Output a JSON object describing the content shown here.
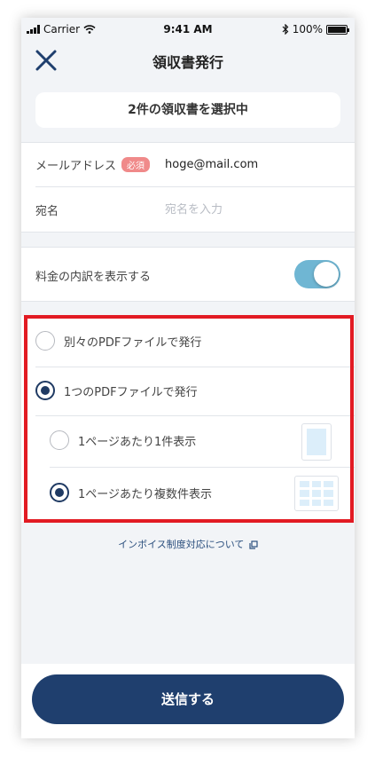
{
  "status_bar": {
    "carrier": "Carrier",
    "time": "9:41 AM",
    "battery": "100%"
  },
  "nav": {
    "title": "領収書発行"
  },
  "selection": {
    "summary": "2件の領収書を選択中"
  },
  "form": {
    "email_label": "メールアドレス",
    "required_badge": "必須",
    "email_value": "hoge@mail.com",
    "address_label": "宛名",
    "address_placeholder": "宛名を入力"
  },
  "breakdown": {
    "label": "料金の内訳を表示する",
    "enabled": true
  },
  "options": {
    "separate_pdf": "別々のPDFファイルで発行",
    "single_pdf": "1つのPDFファイルで発行",
    "one_per_page": "1ページあたり1件表示",
    "multi_per_page": "1ページあたり複数件表示"
  },
  "invoice_link": {
    "label": "インボイス制度対応について"
  },
  "submit": {
    "label": "送信する"
  },
  "colors": {
    "primary": "#1f3f6e",
    "toggle_on": "#6fb6d3",
    "highlight": "#e21b23",
    "required": "#f08a8a"
  }
}
